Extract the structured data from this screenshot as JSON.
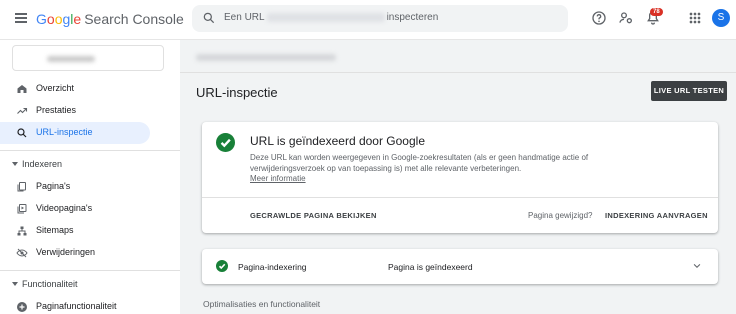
{
  "app": {
    "brand_letters": [
      "G",
      "o",
      "o",
      "g",
      "l",
      "e"
    ],
    "product": "Search Console"
  },
  "search": {
    "prefix": "Een URL",
    "suffix": "inspecteren"
  },
  "header": {
    "notification_count": "78",
    "avatar_letter": "S"
  },
  "sidebar": {
    "items": [
      {
        "label": "Overzicht",
        "icon": "home-icon"
      },
      {
        "label": "Prestaties",
        "icon": "trending-up-icon"
      },
      {
        "label": "URL-inspectie",
        "icon": "search-icon",
        "active": true
      }
    ],
    "sections": [
      {
        "title": "Indexeren",
        "items": [
          {
            "label": "Pagina's",
            "icon": "pages-icon"
          },
          {
            "label": "Videopagina's",
            "icon": "video-pages-icon"
          },
          {
            "label": "Sitemaps",
            "icon": "sitemap-icon"
          },
          {
            "label": "Verwijderingen",
            "icon": "eye-off-icon"
          }
        ]
      },
      {
        "title": "Functionaliteit",
        "items": [
          {
            "label": "Paginafunctionaliteit",
            "icon": "plus-circle-icon"
          }
        ]
      }
    ]
  },
  "main": {
    "title": "URL-inspectie",
    "live_test_label": "LIVE URL TESTEN",
    "status_card": {
      "heading": "URL is geïndexeerd door Google",
      "description": "Deze URL kan worden weergegeven in Google-zoekresultaten (als er geen handmatige actie of verwijderingsverzoek op van toepassing is) met alle relevante verbeteringen.",
      "more_link": "Meer informatie",
      "crawled_label": "GECRAWLDE PAGINA BEKIJKEN",
      "changed_question": "Pagina gewijzigd?",
      "request_label": "INDEXERING AANVRAGEN"
    },
    "indexing_row": {
      "label": "Pagina-indexering",
      "status": "Pagina is geïndexeerd"
    },
    "optimizations_title": "Optimalisaties en functionaliteit"
  },
  "colors": {
    "accent": "#1a73e8",
    "success": "#188038",
    "badge": "#d93025",
    "button_dark": "#3c4043"
  }
}
